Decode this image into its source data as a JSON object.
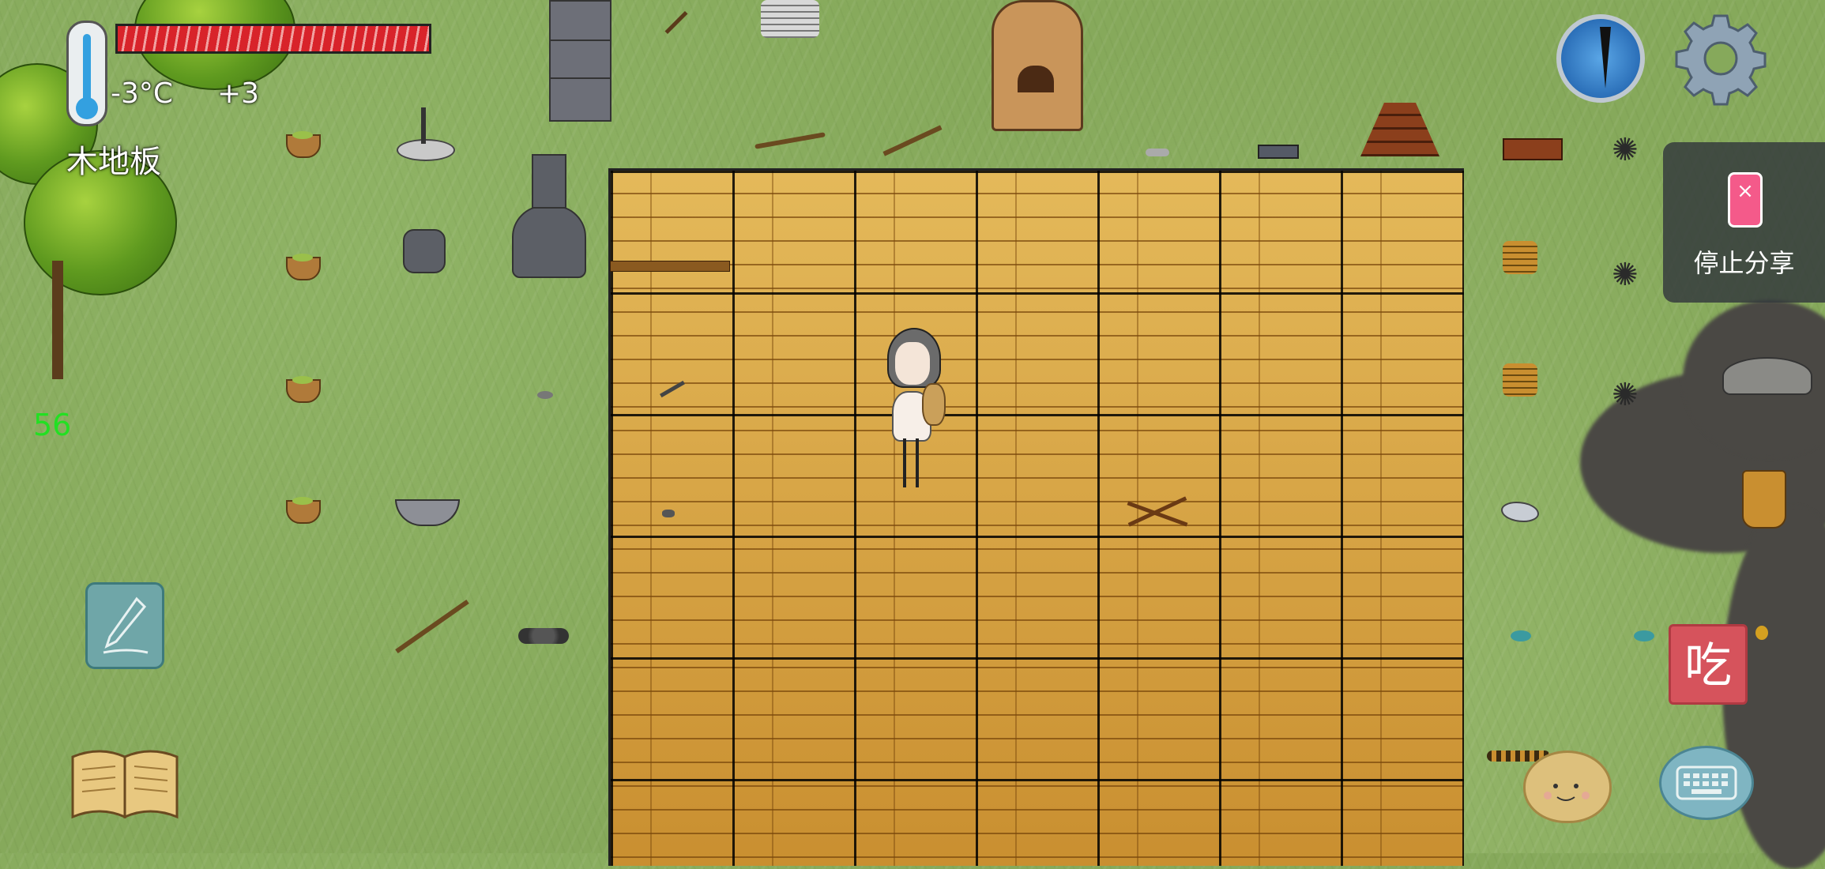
{
  "hud": {
    "temperature": "-3°C",
    "temperature_delta": "+3",
    "tile_name": "木地板",
    "fps": "56",
    "health_fraction": 1.0
  },
  "share": {
    "label": "停止分享",
    "icon": "×"
  },
  "buttons": {
    "eat_label": "吃"
  },
  "icons": {
    "compass": "compass-icon",
    "settings": "gear-icon",
    "pen": "pen-icon",
    "book": "book-icon",
    "emote": "face-icon",
    "keyboard": "keyboard-icon",
    "stop_share": "phone-x-icon"
  },
  "colors": {
    "grass": "#86a95b",
    "floor": "#d9a94a",
    "health": "#d8232a",
    "eat_button": "#d6535c",
    "fps": "#22e022"
  }
}
